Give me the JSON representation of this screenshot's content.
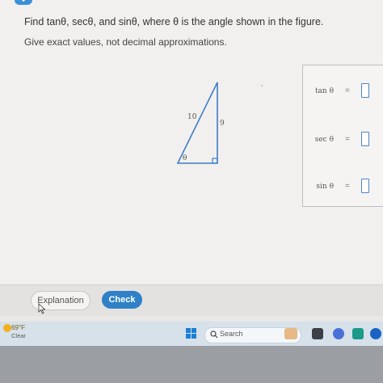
{
  "question": {
    "text": "Find tanθ, secθ, and sinθ, where θ is the angle shown in the figure.",
    "instruction": "Give exact values, not decimal approximations."
  },
  "figure": {
    "hypotenuse": "10",
    "opposite": "9",
    "angle": "θ"
  },
  "answers": [
    {
      "label": "tan θ",
      "eq": "=",
      "value": ""
    },
    {
      "label": "sec θ",
      "eq": "=",
      "value": ""
    },
    {
      "label": "sin θ",
      "eq": "=",
      "value": ""
    }
  ],
  "buttons": {
    "explanation": "Explanation",
    "check": "Check"
  },
  "taskbar": {
    "temperature": "69°F",
    "condition": "Clear",
    "search_placeholder": "Search"
  },
  "colors": {
    "accent": "#2f80c7",
    "triangle": "#3d7cc9"
  }
}
